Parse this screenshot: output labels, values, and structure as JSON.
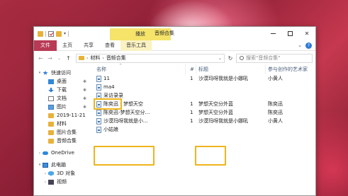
{
  "window": {
    "title": "音频合集",
    "context_tab": "播放",
    "buttons": {
      "minimize": "",
      "maximize": "",
      "close": "✕"
    }
  },
  "quick_access_toolbar": {
    "dropdown": "▾"
  },
  "ribbon": {
    "tabs": [
      "文件",
      "主页",
      "共享",
      "查看",
      "音乐工具"
    ],
    "collapse": "⌄",
    "help": "?"
  },
  "address": {
    "nav_back": "←",
    "nav_forward": "→",
    "nav_recent": "⌄",
    "nav_up": "↑",
    "path": [
      "材料",
      "音频合集"
    ],
    "separator": "›",
    "dropdown": "⌄",
    "refresh": "↻",
    "search_placeholder": "搜索\"音频合集\""
  },
  "sidebar": {
    "items": [
      {
        "label": "快速访问",
        "icon": "star-icon",
        "pinned": false
      },
      {
        "label": "桌面",
        "icon": "desktop-icon",
        "pinned": true
      },
      {
        "label": "下载",
        "icon": "download-icon",
        "pinned": true
      },
      {
        "label": "文档",
        "icon": "document-icon",
        "pinned": true
      },
      {
        "label": "图片",
        "icon": "pictures-icon",
        "pinned": true
      },
      {
        "label": "2019-11-21",
        "icon": "folder-icon",
        "pinned": false
      },
      {
        "label": "材料",
        "icon": "folder-icon",
        "pinned": false
      },
      {
        "label": "图片合集",
        "icon": "folder-icon",
        "pinned": false
      },
      {
        "label": "音频合集",
        "icon": "folder-icon",
        "pinned": false
      },
      {
        "label": "OneDrive",
        "icon": "cloud-icon",
        "pinned": false
      },
      {
        "label": "此电脑",
        "icon": "computer-icon",
        "pinned": false
      },
      {
        "label": "3D 对象",
        "icon": "3d-objects-icon",
        "pinned": false
      },
      {
        "label": "视频",
        "icon": "video-icon",
        "pinned": false
      }
    ],
    "pin_glyph": "✱",
    "expand_glyph": "›"
  },
  "columns": {
    "name": "名称",
    "number": "#",
    "title": "标题",
    "artist": "参与创作的艺术家"
  },
  "files": [
    {
      "name": "11",
      "number": "1",
      "title": "沙漠玛呀我就是小娜吼",
      "artist": "小黄人"
    },
    {
      "name": "ma4",
      "number": "",
      "title": "",
      "artist": ""
    },
    {
      "name": "采访录录",
      "number": "",
      "title": "",
      "artist": ""
    },
    {
      "name": "陈奕迅 - 梦想天空",
      "number": "1",
      "title": "梦想天空分外蓝",
      "artist": "陈奕迅"
    },
    {
      "name": "陈奕迅-梦想天空分...",
      "number": "1",
      "title": "梦想天空分外蓝",
      "artist": "陈奕迅"
    },
    {
      "name": "沙漠玛呀我就是小...",
      "number": "1",
      "title": "沙漠玛呀我就是小娜吼",
      "artist": "小黄人"
    },
    {
      "name": "小姑娘",
      "number": "",
      "title": "",
      "artist": ""
    }
  ],
  "colors": {
    "accent_file_tab": "#b83a55",
    "highlight_box": "#f0b41c",
    "context_tab": "#f5e36a"
  }
}
